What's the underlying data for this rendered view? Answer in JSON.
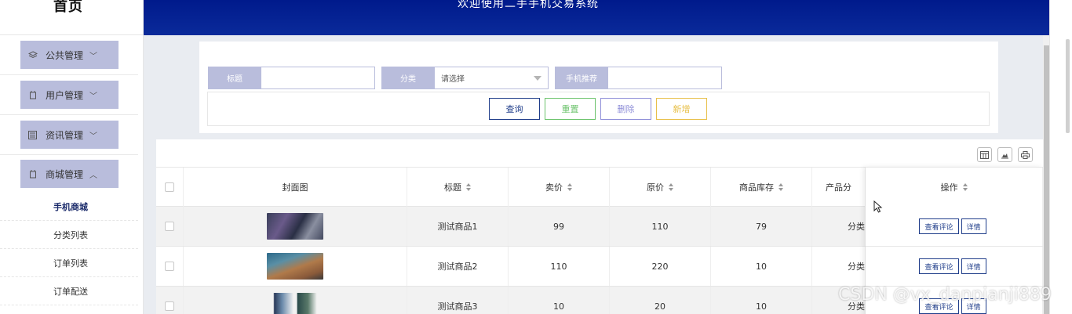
{
  "sidebar": {
    "brand": "首页",
    "menus": [
      {
        "label": "公共管理",
        "icon": "layers-icon",
        "chevron": "chevron-down-icon"
      },
      {
        "label": "用户管理",
        "icon": "user-icon",
        "chevron": "chevron-down-icon"
      },
      {
        "label": "资讯管理",
        "icon": "news-icon",
        "chevron": "chevron-down-icon"
      },
      {
        "label": "商城管理",
        "icon": "shop-icon",
        "chevron": "chevron-up-icon"
      }
    ],
    "submenu": [
      {
        "label": "手机商城",
        "active": true
      },
      {
        "label": "分类列表"
      },
      {
        "label": "订单列表"
      },
      {
        "label": "订单配送"
      }
    ]
  },
  "header": {
    "title": "欢迎使用二手手机交易系统"
  },
  "search": {
    "title_label": "标题",
    "title_value": "",
    "category_label": "分类",
    "category_value": "请选择",
    "recommend_label": "手机推荐",
    "recommend_value": ""
  },
  "buttons": {
    "query": "查询",
    "reset": "重置",
    "delete": "删除",
    "add": "新增"
  },
  "colors": {
    "header_bg": "#001a8c",
    "menu_bg": "#b9bddc",
    "query": "#1f3d8a",
    "reset": "#6cc36c",
    "delete": "#8f8fd8",
    "add": "#e8c04a"
  },
  "table": {
    "columns": [
      "封面图",
      "标题",
      "卖价",
      "原价",
      "商品库存",
      "产品分",
      "操作"
    ],
    "rows": [
      {
        "title": "测试商品1",
        "price": "99",
        "original": "110",
        "stock": "79",
        "category": "分类"
      },
      {
        "title": "测试商品2",
        "price": "110",
        "original": "220",
        "stock": "10",
        "category": "分类"
      },
      {
        "title": "测试商品3",
        "price": "10",
        "original": "20",
        "stock": "10",
        "category": "分类"
      }
    ],
    "actions": {
      "comments": "查看评论",
      "detail": "详情"
    }
  },
  "watermark": "CSDN @vx_danpianji889"
}
